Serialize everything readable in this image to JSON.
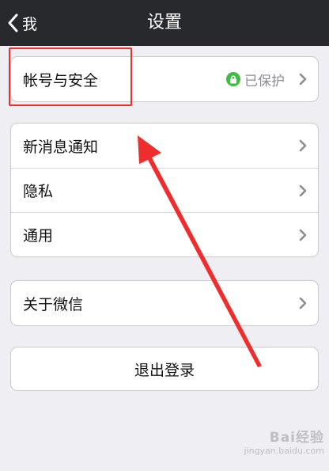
{
  "nav": {
    "back_label": "我",
    "title": "设置"
  },
  "account_group": {
    "items": [
      {
        "label": "帐号与安全",
        "status": "已保护",
        "status_icon": "lock-icon"
      }
    ]
  },
  "settings_group": {
    "items": [
      {
        "label": "新消息通知"
      },
      {
        "label": "隐私"
      },
      {
        "label": "通用"
      }
    ]
  },
  "about_group": {
    "items": [
      {
        "label": "关于微信"
      }
    ]
  },
  "logout": {
    "label": "退出登录"
  },
  "annotation": {
    "color": "#ef2d2d"
  },
  "watermark": {
    "logo": "Bai经验",
    "sub": "jingyan.baidu.com"
  },
  "colors": {
    "nav_background": "#27292d",
    "page_background": "#eeeef3",
    "protected_green": "#3fbd3f"
  }
}
